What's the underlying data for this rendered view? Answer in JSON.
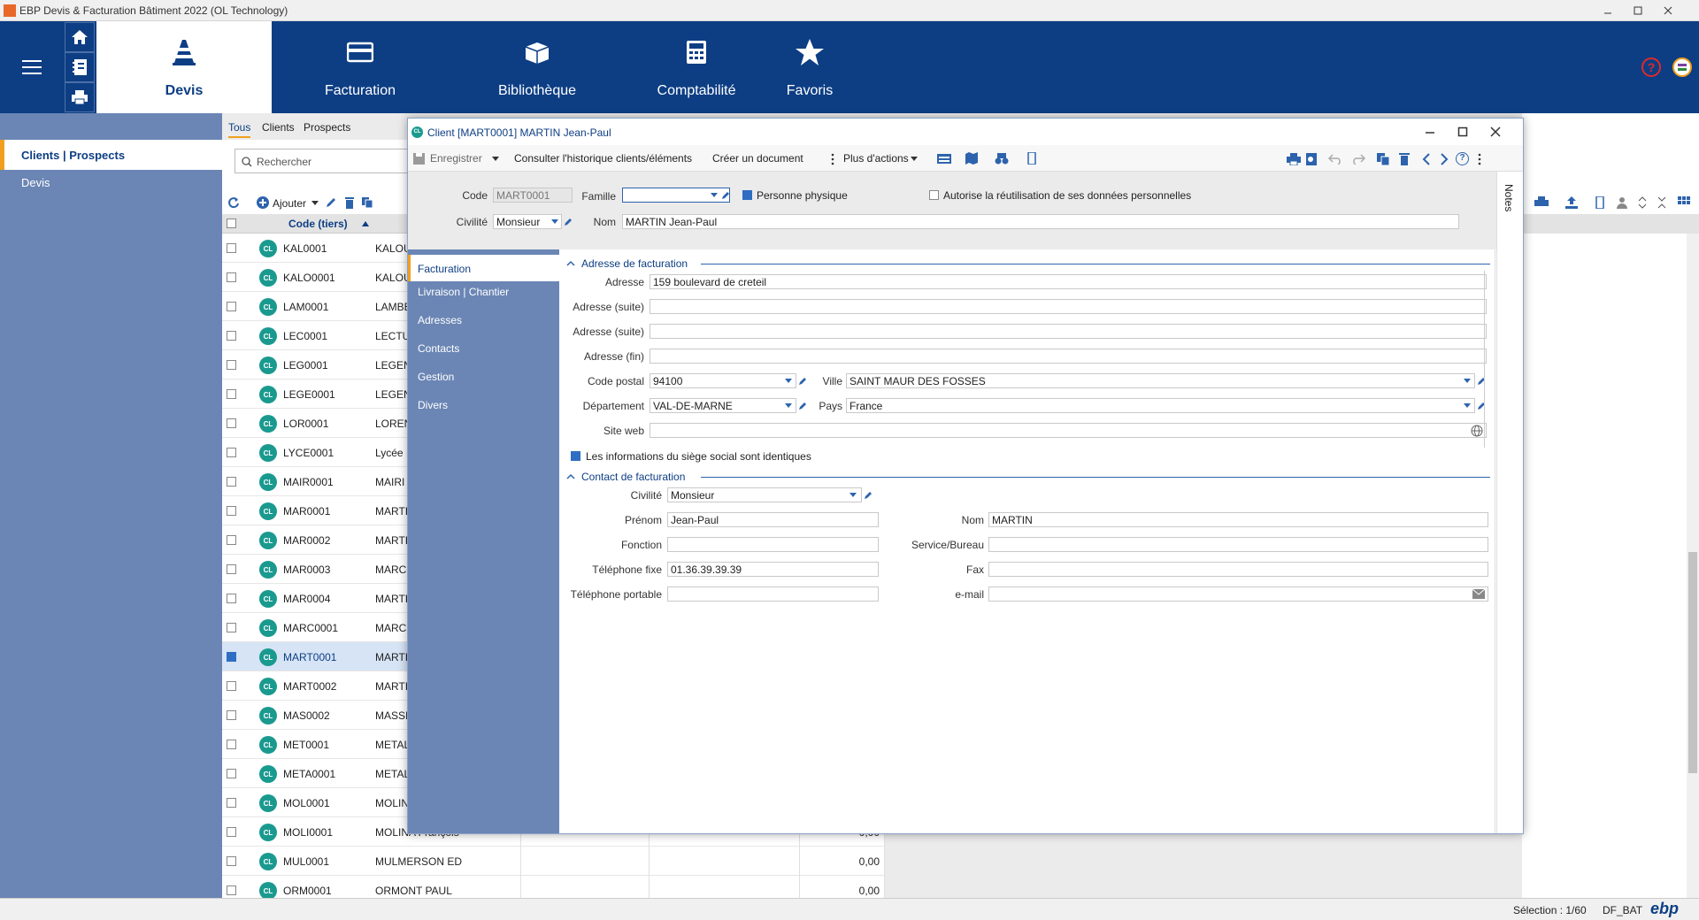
{
  "window": {
    "title": "EBP Devis & Facturation Bâtiment 2022 (OL Technology)"
  },
  "ribbon": {
    "tabs": [
      {
        "label": "Devis",
        "icon": "cone-icon"
      },
      {
        "label": "Facturation",
        "icon": "card-icon"
      },
      {
        "label": "Bibliothèque",
        "icon": "box-icon"
      },
      {
        "label": "Comptabilité",
        "icon": "calculator-icon"
      },
      {
        "label": "Favoris",
        "icon": "star-icon"
      }
    ]
  },
  "nav": {
    "header": "Clients | Prospects",
    "item": "Devis"
  },
  "list": {
    "tabs": [
      "Tous",
      "Clients",
      "Prospects"
    ],
    "search_placeholder": "Rechercher",
    "add_label": "Ajouter",
    "column_code": "Code (tiers)",
    "badge": "CL",
    "rows": [
      {
        "code": "KAL0001",
        "name": "KALOU",
        "amount": "",
        "selected": false
      },
      {
        "code": "KALO0001",
        "name": "KALOU",
        "amount": "",
        "selected": false
      },
      {
        "code": "LAM0001",
        "name": "LAMBE",
        "amount": "",
        "selected": false
      },
      {
        "code": "LEC0001",
        "name": "LECTU",
        "amount": "",
        "selected": false
      },
      {
        "code": "LEG0001",
        "name": "LEGEN",
        "amount": "",
        "selected": false
      },
      {
        "code": "LEGE0001",
        "name": "LEGEN",
        "amount": "",
        "selected": false
      },
      {
        "code": "LOR0001",
        "name": "LOREN",
        "amount": "",
        "selected": false
      },
      {
        "code": "LYCE0001",
        "name": "Lycée",
        "amount": "",
        "selected": false
      },
      {
        "code": "MAIR0001",
        "name": "MAIRI",
        "amount": "",
        "selected": false
      },
      {
        "code": "MAR0001",
        "name": "MARTI",
        "amount": "",
        "selected": false
      },
      {
        "code": "MAR0002",
        "name": "MARTI",
        "amount": "",
        "selected": false
      },
      {
        "code": "MAR0003",
        "name": "MARCH",
        "amount": "",
        "selected": false
      },
      {
        "code": "MAR0004",
        "name": "MARTI",
        "amount": "",
        "selected": false
      },
      {
        "code": "MARC0001",
        "name": "MARCH",
        "amount": "",
        "selected": false
      },
      {
        "code": "MART0001",
        "name": "MARTI",
        "amount": "",
        "selected": true
      },
      {
        "code": "MART0002",
        "name": "MARTI",
        "amount": "",
        "selected": false
      },
      {
        "code": "MAS0002",
        "name": "MASSI",
        "amount": "",
        "selected": false
      },
      {
        "code": "MET0001",
        "name": "METAL",
        "amount": "",
        "selected": false
      },
      {
        "code": "META0001",
        "name": "METAL",
        "amount": "",
        "selected": false
      },
      {
        "code": "MOL0001",
        "name": "MOLIN",
        "amount": "",
        "selected": false
      },
      {
        "code": "MOLI0001",
        "name": "MOLINA François",
        "amount": "0,00",
        "selected": false
      },
      {
        "code": "MUL0001",
        "name": "MULMERSON ED",
        "amount": "0,00",
        "selected": false
      },
      {
        "code": "ORM0001",
        "name": "ORMONT PAUL",
        "amount": "0,00",
        "selected": false
      }
    ]
  },
  "status": {
    "selection": "Sélection : 1/60",
    "db": "DF_BAT",
    "brand": "ebp"
  },
  "dialog": {
    "badge": "CL",
    "title": "Client [MART0001] MARTIN Jean-Paul",
    "toolbar": {
      "save": "Enregistrer",
      "history": "Consulter l'historique clients/éléments",
      "create_doc": "Créer un document",
      "more": "Plus d'actions"
    },
    "header": {
      "code_label": "Code",
      "code_value": "MART0001",
      "famille_label": "Famille",
      "famille_value": "",
      "personne_label": "Personne physique",
      "autorise_label": "Autorise la réutilisation de ses données personnelles",
      "civilite_label": "Civilité",
      "civilite_value": "Monsieur",
      "nom_label": "Nom",
      "nom_value": "MARTIN Jean-Paul"
    },
    "notes": "Notes",
    "side": [
      "Facturation",
      "Livraison | Chantier",
      "Adresses",
      "Contacts",
      "Gestion",
      "Divers"
    ],
    "billing": {
      "title": "Adresse de facturation",
      "adresse_label": "Adresse",
      "adresse_value": "159 boulevard de creteil",
      "suite1_label": "Adresse (suite)",
      "suite2_label": "Adresse (suite)",
      "fin_label": "Adresse (fin)",
      "cp_label": "Code postal",
      "cp_value": "94100",
      "ville_label": "Ville",
      "ville_value": "SAINT MAUR DES FOSSES",
      "dept_label": "Département",
      "dept_value": "VAL-DE-MARNE",
      "pays_label": "Pays",
      "pays_value": "France",
      "web_label": "Site web",
      "siege_label": "Les informations du siège social sont identiques"
    },
    "contact": {
      "title": "Contact de facturation",
      "civilite_label": "Civilité",
      "civilite_value": "Monsieur",
      "prenom_label": "Prénom",
      "prenom_value": "Jean-Paul",
      "nom_label": "Nom",
      "nom_value": "MARTIN",
      "fonction_label": "Fonction",
      "service_label": "Service/Bureau",
      "tel_label": "Téléphone fixe",
      "tel_value": "01.36.39.39.39",
      "fax_label": "Fax",
      "mobile_label": "Téléphone portable",
      "email_label": "e-mail"
    }
  },
  "colors": {
    "ribbon": "#0d3e84",
    "nav": "#6b86b5",
    "accent": "#f0a01e",
    "badge": "#1a9a8f",
    "help": "#e0292b"
  }
}
